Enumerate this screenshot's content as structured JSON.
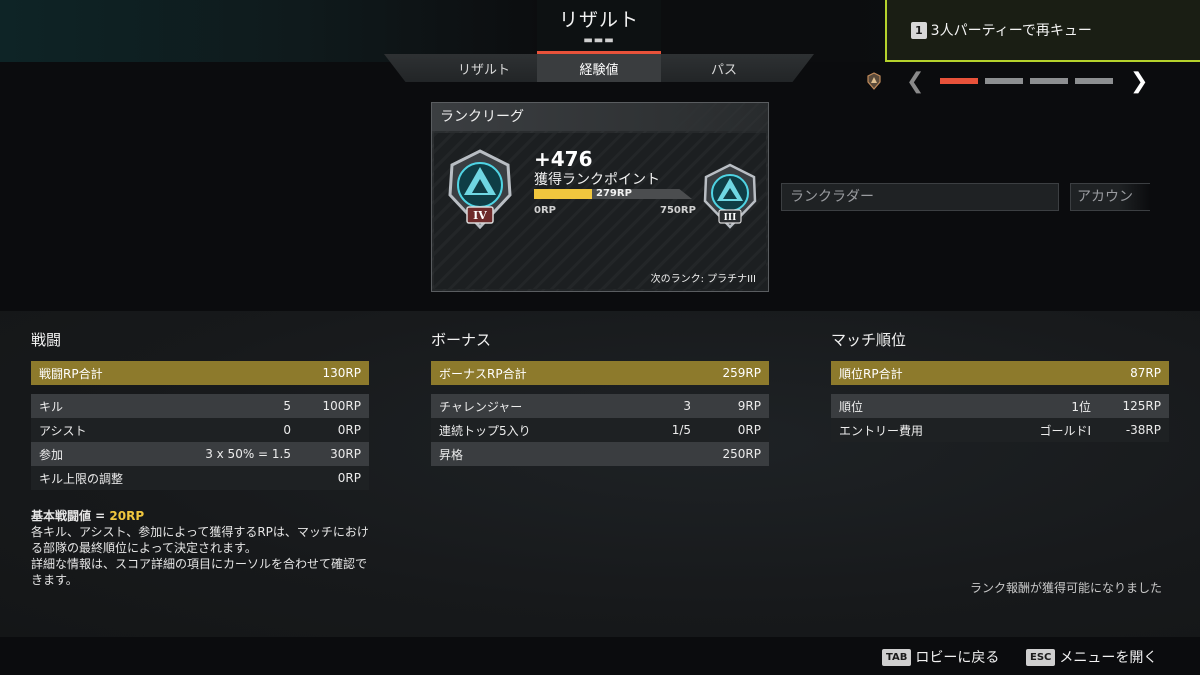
{
  "header": {
    "title": "リザルト",
    "tabs": [
      {
        "label": "リザルト",
        "active": false
      },
      {
        "label": "経験値",
        "active": true
      },
      {
        "label": "パス",
        "active": false
      }
    ]
  },
  "queue": {
    "key": "1",
    "label": "3人パーティーで再キュー"
  },
  "pager": {
    "pages": 4,
    "active_index": 0
  },
  "rank_card": {
    "title": "ランクリーグ",
    "gain": "+476",
    "gain_label": "獲得ランクポイント",
    "current_rp": "279RP",
    "current_rp_fraction": 0.37,
    "min_rp": "0RP",
    "max_rp": "750RP",
    "current_tier": "IV",
    "next_tier": "III",
    "next_rank": "次のランク: プラチナIII"
  },
  "buttons": {
    "ladder": "ランクラダー",
    "account": "アカウン"
  },
  "combat": {
    "title": "戦闘",
    "total": {
      "name": "戦闘RP合計",
      "value": "130RP"
    },
    "rows": [
      {
        "name": "キル",
        "c1": "5",
        "c2": "100RP"
      },
      {
        "name": "アシスト",
        "c1": "0",
        "c2": "0RP"
      },
      {
        "name": "参加",
        "c1": "3 x 50% = 1.5",
        "c2": "30RP"
      },
      {
        "name": "キル上限の調整",
        "c1": "",
        "c2": "0RP"
      }
    ]
  },
  "bonus": {
    "title": "ボーナス",
    "total": {
      "name": "ボーナスRP合計",
      "value": "259RP"
    },
    "rows": [
      {
        "name": "チャレンジャー",
        "c1": "3",
        "c2": "9RP"
      },
      {
        "name": "連続トップ5入り",
        "c1": "1/5",
        "c2": "0RP"
      },
      {
        "name": "昇格",
        "c1": "",
        "c2": "250RP"
      }
    ]
  },
  "placement": {
    "title": "マッチ順位",
    "total": {
      "name": "順位RP合計",
      "value": "87RP"
    },
    "rows": [
      {
        "name": "順位",
        "c1": "1位",
        "c2": "125RP"
      },
      {
        "name": "エントリー費用",
        "c1": "ゴールドI",
        "c2": "-38RP"
      }
    ]
  },
  "note": {
    "base_label": "基本戦闘値 = ",
    "base_value": "20RP",
    "line1": "各キル、アシスト、参加によって獲得するRPは、マッチにおける部隊の最終順位によって決定されます。",
    "line2": "詳細な情報は、スコア詳細の項目にカーソルを合わせて確認できます。"
  },
  "reward_note": "ランク報酬が獲得可能になりました",
  "footer": {
    "back_key": "TAB",
    "back_label": "ロビーに戻る",
    "menu_key": "ESC",
    "menu_label": "メニューを開く"
  },
  "colors": {
    "accent": "#e8523a",
    "gold": "#f0c63e",
    "queue": "#b5d22c",
    "total_row": "#8d7a2c"
  }
}
